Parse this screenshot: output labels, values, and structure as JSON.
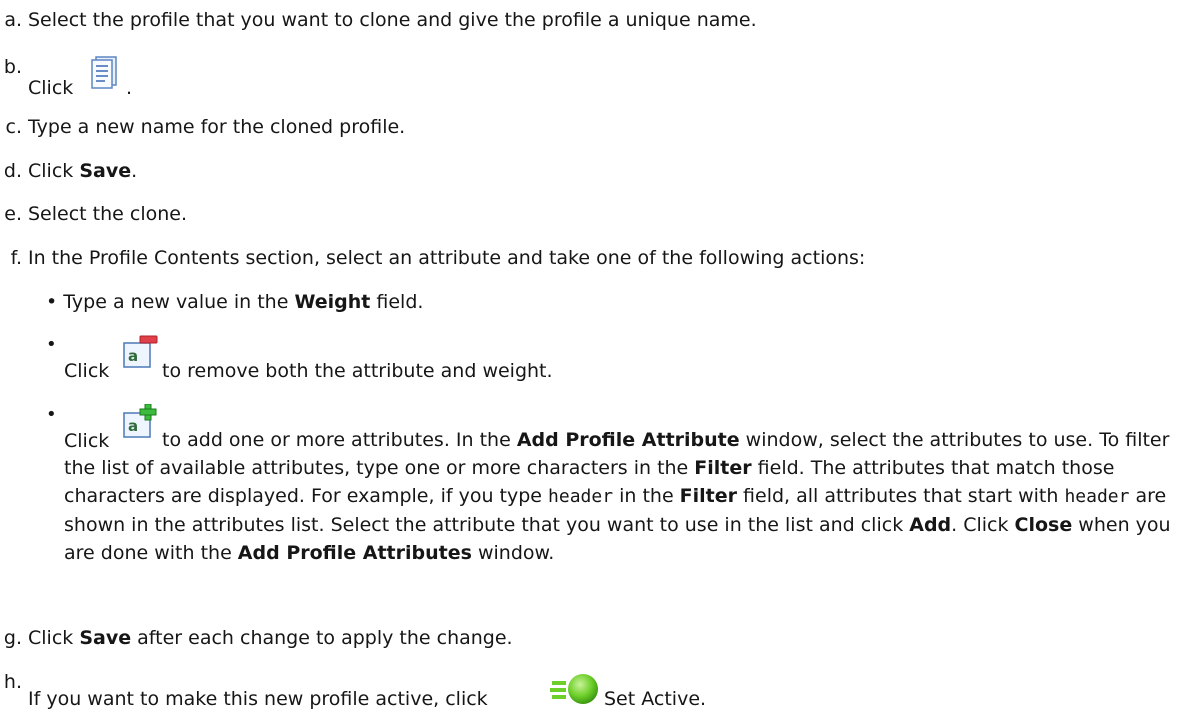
{
  "steps": {
    "a": {
      "marker": "a.",
      "text": "Select the profile that you want to clone and give the profile a unique name."
    },
    "b": {
      "marker": "b.",
      "pre": "Click",
      "post": "."
    },
    "c": {
      "marker": "c.",
      "text": "Type a new name for the cloned profile."
    },
    "d": {
      "marker": "d.",
      "pre": "Click ",
      "bold": "Save",
      "post": "."
    },
    "e": {
      "marker": "e.",
      "text": "Select the clone."
    },
    "f": {
      "marker": "f.",
      "text": "In the Profile Contents section, select an attribute and take one of the following actions:",
      "bullet1": {
        "bullet": "•",
        "pre": "Type a new value in the ",
        "bold": "Weight",
        "post": " field."
      },
      "bullet2": {
        "bullet": "•",
        "pre": "Click",
        "post": " to remove both the attribute and weight."
      },
      "bullet3": {
        "bullet": "•",
        "pre": "Click",
        "t1": " to add one or more attributes. In the ",
        "b1": "Add Profile Attribute",
        "t2": " window, select the attributes to use. To filter the list of available attributes, type one or more characters in the ",
        "b2": "Filter",
        "t3": " field. The attributes that match those characters are displayed. For example, if you type ",
        "code1": "header",
        "t4": " in the ",
        "b3": "Filter",
        "t5": " field, all attributes that start with ",
        "code2": "header",
        "t6": " are shown in the attributes list. Select the attribute that you want to use in the list and click ",
        "b4": "Add",
        "t7": ". Click ",
        "b5": "Close",
        "t8": " when you are done with the ",
        "b6": "Add Profile Attributes",
        "t9": " window."
      }
    },
    "g": {
      "marker": "g.",
      "pre": "Click ",
      "bold": "Save",
      "post": " after each change to apply the change."
    },
    "h": {
      "marker": "h.",
      "pre": "If you want to make this new profile active, click",
      "post": " Set Active."
    }
  },
  "icons": {
    "clone": "clone-profile-icon",
    "remove": "remove-attribute-icon",
    "add": "add-attribute-icon",
    "active": "set-active-icon"
  }
}
